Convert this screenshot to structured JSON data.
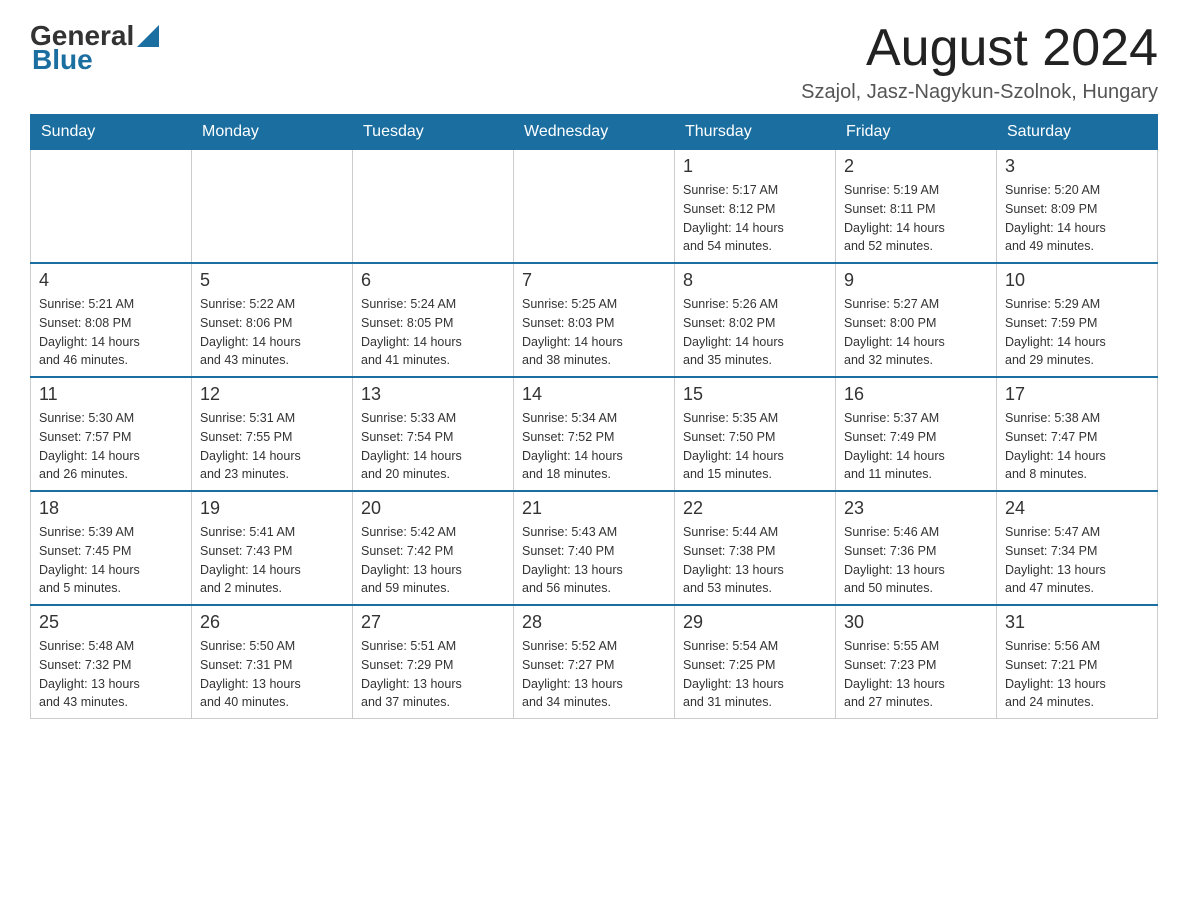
{
  "header": {
    "month_title": "August 2024",
    "location": "Szajol, Jasz-Nagykun-Szolnok, Hungary",
    "logo_general": "General",
    "logo_blue": "Blue"
  },
  "days_of_week": [
    "Sunday",
    "Monday",
    "Tuesday",
    "Wednesday",
    "Thursday",
    "Friday",
    "Saturday"
  ],
  "weeks": [
    [
      {
        "day": "",
        "info": ""
      },
      {
        "day": "",
        "info": ""
      },
      {
        "day": "",
        "info": ""
      },
      {
        "day": "",
        "info": ""
      },
      {
        "day": "1",
        "info": "Sunrise: 5:17 AM\nSunset: 8:12 PM\nDaylight: 14 hours\nand 54 minutes."
      },
      {
        "day": "2",
        "info": "Sunrise: 5:19 AM\nSunset: 8:11 PM\nDaylight: 14 hours\nand 52 minutes."
      },
      {
        "day": "3",
        "info": "Sunrise: 5:20 AM\nSunset: 8:09 PM\nDaylight: 14 hours\nand 49 minutes."
      }
    ],
    [
      {
        "day": "4",
        "info": "Sunrise: 5:21 AM\nSunset: 8:08 PM\nDaylight: 14 hours\nand 46 minutes."
      },
      {
        "day": "5",
        "info": "Sunrise: 5:22 AM\nSunset: 8:06 PM\nDaylight: 14 hours\nand 43 minutes."
      },
      {
        "day": "6",
        "info": "Sunrise: 5:24 AM\nSunset: 8:05 PM\nDaylight: 14 hours\nand 41 minutes."
      },
      {
        "day": "7",
        "info": "Sunrise: 5:25 AM\nSunset: 8:03 PM\nDaylight: 14 hours\nand 38 minutes."
      },
      {
        "day": "8",
        "info": "Sunrise: 5:26 AM\nSunset: 8:02 PM\nDaylight: 14 hours\nand 35 minutes."
      },
      {
        "day": "9",
        "info": "Sunrise: 5:27 AM\nSunset: 8:00 PM\nDaylight: 14 hours\nand 32 minutes."
      },
      {
        "day": "10",
        "info": "Sunrise: 5:29 AM\nSunset: 7:59 PM\nDaylight: 14 hours\nand 29 minutes."
      }
    ],
    [
      {
        "day": "11",
        "info": "Sunrise: 5:30 AM\nSunset: 7:57 PM\nDaylight: 14 hours\nand 26 minutes."
      },
      {
        "day": "12",
        "info": "Sunrise: 5:31 AM\nSunset: 7:55 PM\nDaylight: 14 hours\nand 23 minutes."
      },
      {
        "day": "13",
        "info": "Sunrise: 5:33 AM\nSunset: 7:54 PM\nDaylight: 14 hours\nand 20 minutes."
      },
      {
        "day": "14",
        "info": "Sunrise: 5:34 AM\nSunset: 7:52 PM\nDaylight: 14 hours\nand 18 minutes."
      },
      {
        "day": "15",
        "info": "Sunrise: 5:35 AM\nSunset: 7:50 PM\nDaylight: 14 hours\nand 15 minutes."
      },
      {
        "day": "16",
        "info": "Sunrise: 5:37 AM\nSunset: 7:49 PM\nDaylight: 14 hours\nand 11 minutes."
      },
      {
        "day": "17",
        "info": "Sunrise: 5:38 AM\nSunset: 7:47 PM\nDaylight: 14 hours\nand 8 minutes."
      }
    ],
    [
      {
        "day": "18",
        "info": "Sunrise: 5:39 AM\nSunset: 7:45 PM\nDaylight: 14 hours\nand 5 minutes."
      },
      {
        "day": "19",
        "info": "Sunrise: 5:41 AM\nSunset: 7:43 PM\nDaylight: 14 hours\nand 2 minutes."
      },
      {
        "day": "20",
        "info": "Sunrise: 5:42 AM\nSunset: 7:42 PM\nDaylight: 13 hours\nand 59 minutes."
      },
      {
        "day": "21",
        "info": "Sunrise: 5:43 AM\nSunset: 7:40 PM\nDaylight: 13 hours\nand 56 minutes."
      },
      {
        "day": "22",
        "info": "Sunrise: 5:44 AM\nSunset: 7:38 PM\nDaylight: 13 hours\nand 53 minutes."
      },
      {
        "day": "23",
        "info": "Sunrise: 5:46 AM\nSunset: 7:36 PM\nDaylight: 13 hours\nand 50 minutes."
      },
      {
        "day": "24",
        "info": "Sunrise: 5:47 AM\nSunset: 7:34 PM\nDaylight: 13 hours\nand 47 minutes."
      }
    ],
    [
      {
        "day": "25",
        "info": "Sunrise: 5:48 AM\nSunset: 7:32 PM\nDaylight: 13 hours\nand 43 minutes."
      },
      {
        "day": "26",
        "info": "Sunrise: 5:50 AM\nSunset: 7:31 PM\nDaylight: 13 hours\nand 40 minutes."
      },
      {
        "day": "27",
        "info": "Sunrise: 5:51 AM\nSunset: 7:29 PM\nDaylight: 13 hours\nand 37 minutes."
      },
      {
        "day": "28",
        "info": "Sunrise: 5:52 AM\nSunset: 7:27 PM\nDaylight: 13 hours\nand 34 minutes."
      },
      {
        "day": "29",
        "info": "Sunrise: 5:54 AM\nSunset: 7:25 PM\nDaylight: 13 hours\nand 31 minutes."
      },
      {
        "day": "30",
        "info": "Sunrise: 5:55 AM\nSunset: 7:23 PM\nDaylight: 13 hours\nand 27 minutes."
      },
      {
        "day": "31",
        "info": "Sunrise: 5:56 AM\nSunset: 7:21 PM\nDaylight: 13 hours\nand 24 minutes."
      }
    ]
  ]
}
